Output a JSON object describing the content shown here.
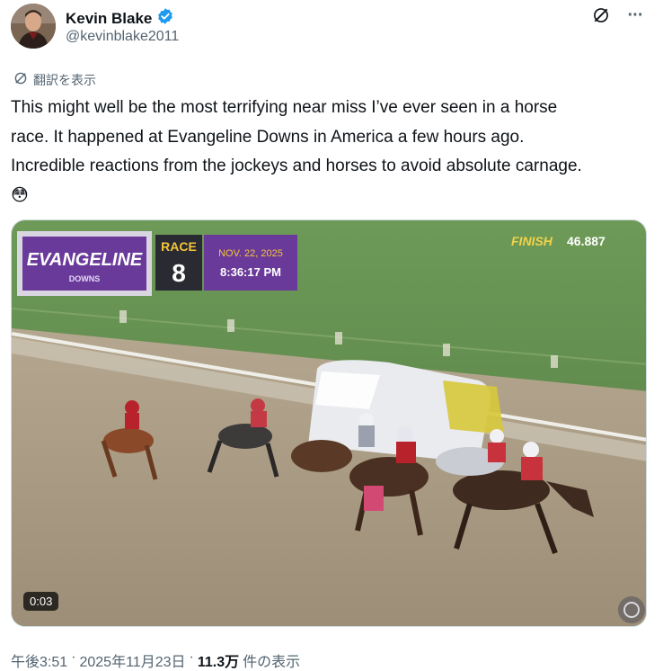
{
  "author": {
    "display_name": "Kevin Blake",
    "handle": "@kevinblake2011",
    "verified_icon": "verified-badge-icon",
    "verified_color": "#1d9bf0"
  },
  "header_actions": {
    "grok_icon": "grok-icon",
    "more_icon": "more-icon",
    "more_glyph": "···"
  },
  "translate": {
    "label": "翻訳を表示",
    "icon": "globe-icon"
  },
  "tweet": {
    "lines": [
      "This might well be the most terrifying near miss I’ve ever seen in a horse",
      "race. It happened at Evangeline Downs in America a few hours ago.",
      "Incredible reactions from the jockeys and horses to avoid absolute carnage.",
      "😳"
    ]
  },
  "video": {
    "timecode": "0:03",
    "overlay": {
      "track_logo": "EVANGELINE",
      "track_sub": "DOWNS",
      "race_label": "RACE",
      "race_number": "8",
      "date": "NOV. 22, 2025",
      "time": "8:36:17 PM",
      "finish_label": "FINISH",
      "finish_time": "46.887"
    }
  },
  "meta": {
    "time": "午後3:51",
    "sep": "·",
    "date": "2025年11月23日",
    "sep2": "·",
    "views": "11.3万",
    "views_suffix": "件の表示"
  },
  "colors": {
    "text": "#0f1419",
    "secondary": "#536471",
    "track_green": "#5c8a4a",
    "dirt": "#a79a84",
    "purple": "#5b2a86"
  }
}
